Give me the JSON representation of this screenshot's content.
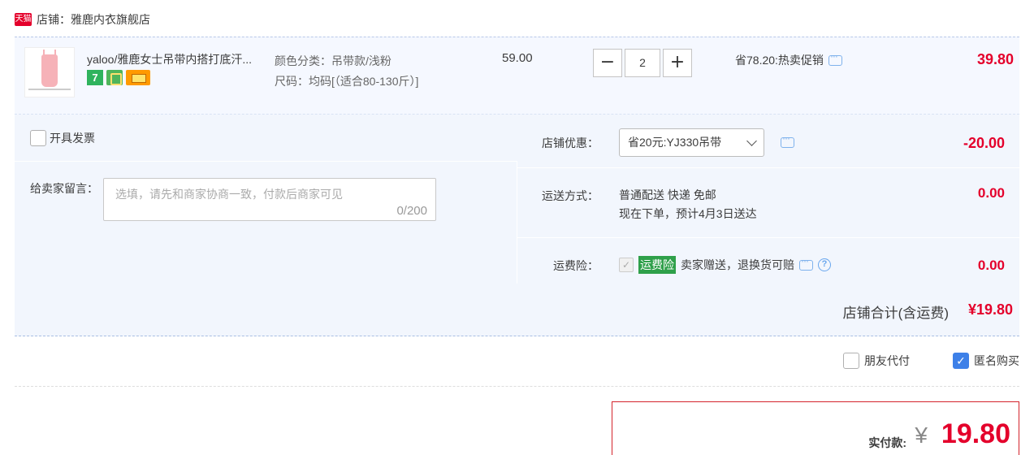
{
  "shop": {
    "badge": "天猫",
    "name": "店铺：雅鹿内衣旗舰店"
  },
  "item": {
    "title": "yaloo/雅鹿女士吊带内搭打底汗...",
    "sku_color": "颜色分类：吊带款/浅粉",
    "sku_size": "尺码：均码[（适合80-130斤）]",
    "unit_price": "59.00",
    "quantity": "2",
    "qty_minus": "−",
    "qty_plus": "+",
    "promo": "省78.20:热卖促销",
    "total": "39.80"
  },
  "options": {
    "invoice_label": "开具发票",
    "message_label": "给卖家留言：",
    "message_placeholder": "选填，请先和商家协商一致，付款后商家可见",
    "message_count": "0/200",
    "coupon_label": "店铺优惠：",
    "coupon_selected": "省20元:YJ330吊带",
    "coupon_value": "-20.00",
    "shipping_label": "运送方式：",
    "shipping_method": "普通配送 快递 免邮",
    "shipping_eta": "现在下单，预计4月3日送达",
    "shipping_value": "0.00",
    "insurance_label": "运费险：",
    "insurance_badge": "运费险",
    "insurance_text": "卖家赠送，退换货可赔",
    "insurance_value": "0.00"
  },
  "shop_total": {
    "label": "店铺合计(含运费)",
    "value": "¥19.80"
  },
  "extra": {
    "friend_pay": "朋友代付",
    "anonymous": "匿名购买"
  },
  "payment": {
    "label": "实付款:",
    "currency": "¥",
    "amount": "19.80"
  },
  "colors": {
    "accent": "#e4002b",
    "panel": "#f2f6fd",
    "checkbox_checked": "#3d80e8"
  }
}
